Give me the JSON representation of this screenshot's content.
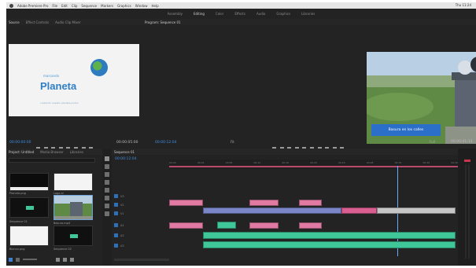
{
  "menubar": {
    "app_name": "Adobe Premiere Pro",
    "items": [
      "File",
      "Edit",
      "Clip",
      "Sequence",
      "Markers",
      "Graphics",
      "Window",
      "Help"
    ],
    "right": "Thu 11:24"
  },
  "workspaces": {
    "items": [
      "Assembly",
      "Editing",
      "Color",
      "Effects",
      "Audio",
      "Graphics",
      "Libraries"
    ],
    "active_index": 1
  },
  "source_monitor": {
    "tabs": [
      "Source",
      "Effect Controls",
      "Audio Clip Mixer"
    ],
    "logo_small": "marcando",
    "logo_text": "Planeta",
    "logo_tagline": "cuidando nuestro planeta juntos",
    "timecode": "00:00:00:00",
    "duration": "00:00:05:00"
  },
  "program_monitor": {
    "tab": "Program: Sequence 01",
    "lower_third": "Basura en los calles",
    "timecode": "00:00:12:04",
    "duration": "00:00:41:13",
    "fit": "Fit",
    "quality": "Full"
  },
  "project_panel": {
    "tabs": [
      "Project: Untitled",
      "Media Browser",
      "Libraries"
    ],
    "search_placeholder": "",
    "items": [
      {
        "label": "Planeta.png",
        "duration": "5:00",
        "kind": "white"
      },
      {
        "label": "Logo.ai",
        "duration": "5:00",
        "kind": "white"
      },
      {
        "label": "Sequence 01",
        "duration": "41:13",
        "kind": "seq"
      },
      {
        "label": "Basura.mp4",
        "duration": "18:22",
        "kind": "photo"
      },
      {
        "label": "Blanco.png",
        "duration": "5:00",
        "kind": "white"
      },
      {
        "label": "Sequence 02",
        "duration": "12:00",
        "kind": "seq"
      }
    ]
  },
  "timeline": {
    "tab": "Sequence 01",
    "timecode": "00:00:12:04",
    "ruler_marks": [
      "00:00",
      "00:04",
      "00:08",
      "00:12",
      "00:16",
      "00:20",
      "00:24",
      "00:28",
      "00:32",
      "00:36",
      "00:40"
    ],
    "video_tracks": [
      "V3",
      "V2",
      "V1"
    ],
    "audio_tracks": [
      "A1",
      "A2",
      "A3"
    ]
  },
  "colors": {
    "accent": "#2f7fc4",
    "timecode": "#3e8ee0",
    "clip_video": "#e07aa3",
    "clip_blue": "#7a86c7",
    "clip_audio": "#3fc79a"
  }
}
